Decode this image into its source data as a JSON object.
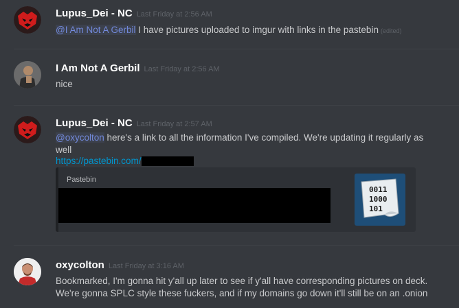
{
  "messages": [
    {
      "username": "Lupus_Dei - NC",
      "timestamp": "Last Friday at 2:56 AM",
      "mention": "@I Am Not A Gerbil",
      "text": " I have pictures uploaded to imgur with links in the pastebin",
      "edited": "(edited)"
    },
    {
      "username": "I Am Not A Gerbil",
      "timestamp": "Last Friday at 2:56 AM",
      "text": "nice"
    },
    {
      "username": "Lupus_Dei - NC",
      "timestamp": "Last Friday at 2:57 AM",
      "mention": "@oxycolton",
      "text_line1": " here's a link to all the information I've compiled.  We're updating it regularly as",
      "text_line2": "well",
      "link": "https://pastebin.com/",
      "embed": {
        "provider": "Pastebin",
        "thumb_lines": [
          "0011",
          "1000",
          "101"
        ]
      }
    },
    {
      "username": "oxycolton",
      "timestamp": "Last Friday at 3:16 AM",
      "text_line1": "Bookmarked, I'm gonna hit y'all up later to see if y'all have corresponding pictures on deck.",
      "text_line2": "We're gonna SPLC style these fuckers, and if my domains go down it'll still be on an .onion"
    }
  ]
}
